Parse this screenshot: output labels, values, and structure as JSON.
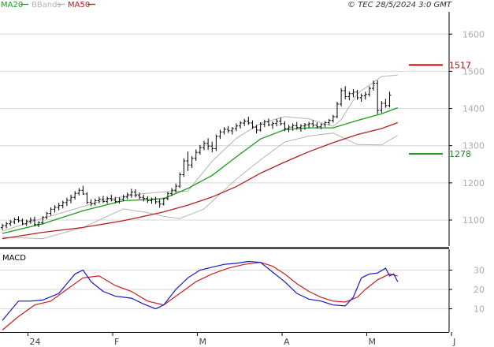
{
  "legend": [
    {
      "label": "MA20",
      "color": "#1a9c1a"
    },
    {
      "label": "BBands",
      "color": "#b4b4b4"
    },
    {
      "label": "MA50",
      "color": "#b41e1e"
    }
  ],
  "copyright": "© TEC 28/5/2024 3:0 GMT",
  "levels": [
    {
      "label": "1517",
      "value": 1517,
      "color": "#cc0000"
    },
    {
      "label": "1278",
      "value": 1278,
      "color": "#1a8c1a"
    }
  ],
  "chart_data": [
    {
      "type": "candlestick",
      "ylim": [
        1030,
        1660
      ],
      "yticks": [
        1100,
        1200,
        1300,
        1400,
        1500,
        1600
      ],
      "ytick_labels": [
        "1100",
        "1200",
        "1300",
        "1400",
        "1500",
        "1600"
      ],
      "x_labels": [
        "24",
        "F",
        "M",
        "A",
        "M",
        "J"
      ],
      "x_label_index": [
        4,
        25,
        46,
        67,
        88,
        109
      ],
      "grid": true,
      "bars": [
        [
          1080,
          1090,
          1073,
          1085
        ],
        [
          1085,
          1095,
          1078,
          1090
        ],
        [
          1090,
          1100,
          1084,
          1095
        ],
        [
          1095,
          1106,
          1089,
          1101
        ],
        [
          1101,
          1110,
          1093,
          1098
        ],
        [
          1098,
          1104,
          1086,
          1090
        ],
        [
          1090,
          1101,
          1084,
          1097
        ],
        [
          1097,
          1107,
          1090,
          1100
        ],
        [
          1100,
          1109,
          1083,
          1088
        ],
        [
          1088,
          1097,
          1081,
          1093
        ],
        [
          1093,
          1110,
          1088,
          1108
        ],
        [
          1108,
          1122,
          1102,
          1118
        ],
        [
          1118,
          1134,
          1112,
          1129
        ],
        [
          1129,
          1140,
          1120,
          1134
        ],
        [
          1134,
          1146,
          1126,
          1139
        ],
        [
          1139,
          1152,
          1131,
          1147
        ],
        [
          1147,
          1160,
          1138,
          1153
        ],
        [
          1153,
          1168,
          1145,
          1161
        ],
        [
          1161,
          1178,
          1155,
          1172
        ],
        [
          1172,
          1186,
          1166,
          1180
        ],
        [
          1180,
          1192,
          1168,
          1170
        ],
        [
          1170,
          1175,
          1143,
          1148
        ],
        [
          1148,
          1156,
          1137,
          1144
        ],
        [
          1144,
          1158,
          1139,
          1152
        ],
        [
          1152,
          1163,
          1145,
          1156
        ],
        [
          1156,
          1165,
          1146,
          1150
        ],
        [
          1150,
          1163,
          1144,
          1158
        ],
        [
          1158,
          1168,
          1150,
          1154
        ],
        [
          1154,
          1162,
          1145,
          1150
        ],
        [
          1150,
          1161,
          1144,
          1156
        ],
        [
          1156,
          1168,
          1150,
          1162
        ],
        [
          1162,
          1174,
          1156,
          1168
        ],
        [
          1168,
          1184,
          1160,
          1175
        ],
        [
          1175,
          1183,
          1161,
          1166
        ],
        [
          1166,
          1174,
          1156,
          1161
        ],
        [
          1161,
          1168,
          1150,
          1158
        ],
        [
          1158,
          1164,
          1146,
          1152
        ],
        [
          1152,
          1160,
          1144,
          1156
        ],
        [
          1156,
          1162,
          1143,
          1149
        ],
        [
          1149,
          1156,
          1133,
          1143
        ],
        [
          1143,
          1160,
          1139,
          1158
        ],
        [
          1158,
          1176,
          1153,
          1171
        ],
        [
          1171,
          1186,
          1165,
          1180
        ],
        [
          1180,
          1198,
          1174,
          1191
        ],
        [
          1191,
          1228,
          1186,
          1222
        ],
        [
          1222,
          1266,
          1216,
          1259
        ],
        [
          1259,
          1284,
          1232,
          1248
        ],
        [
          1248,
          1272,
          1240,
          1266
        ],
        [
          1266,
          1290,
          1259,
          1282
        ],
        [
          1282,
          1302,
          1276,
          1295
        ],
        [
          1295,
          1313,
          1288,
          1306
        ],
        [
          1306,
          1320,
          1289,
          1299
        ],
        [
          1299,
          1311,
          1282,
          1292
        ],
        [
          1292,
          1330,
          1286,
          1325
        ],
        [
          1325,
          1343,
          1318,
          1337
        ],
        [
          1337,
          1350,
          1330,
          1344
        ],
        [
          1344,
          1353,
          1334,
          1340
        ],
        [
          1340,
          1350,
          1330,
          1346
        ],
        [
          1346,
          1360,
          1339,
          1353
        ],
        [
          1353,
          1366,
          1346,
          1361
        ],
        [
          1361,
          1372,
          1353,
          1366
        ],
        [
          1366,
          1378,
          1356,
          1361
        ],
        [
          1361,
          1368,
          1345,
          1350
        ],
        [
          1350,
          1356,
          1333,
          1342
        ],
        [
          1342,
          1363,
          1338,
          1358
        ],
        [
          1358,
          1370,
          1350,
          1364
        ],
        [
          1364,
          1373,
          1352,
          1356
        ],
        [
          1356,
          1365,
          1345,
          1360
        ],
        [
          1360,
          1372,
          1352,
          1366
        ],
        [
          1366,
          1376,
          1354,
          1359
        ],
        [
          1359,
          1366,
          1339,
          1346
        ],
        [
          1346,
          1356,
          1336,
          1350
        ],
        [
          1350,
          1360,
          1340,
          1354
        ],
        [
          1354,
          1364,
          1343,
          1349
        ],
        [
          1349,
          1358,
          1338,
          1353
        ],
        [
          1353,
          1361,
          1343,
          1356
        ],
        [
          1356,
          1364,
          1347,
          1359
        ],
        [
          1359,
          1369,
          1350,
          1355
        ],
        [
          1355,
          1363,
          1346,
          1351
        ],
        [
          1351,
          1360,
          1344,
          1357
        ],
        [
          1357,
          1366,
          1350,
          1362
        ],
        [
          1362,
          1372,
          1355,
          1368
        ],
        [
          1368,
          1383,
          1362,
          1378
        ],
        [
          1378,
          1418,
          1374,
          1412
        ],
        [
          1412,
          1455,
          1406,
          1448
        ],
        [
          1448,
          1460,
          1425,
          1432
        ],
        [
          1432,
          1446,
          1422,
          1440
        ],
        [
          1440,
          1452,
          1430,
          1444
        ],
        [
          1444,
          1450,
          1423,
          1429
        ],
        [
          1429,
          1440,
          1418,
          1434
        ],
        [
          1434,
          1445,
          1424,
          1438
        ],
        [
          1438,
          1460,
          1432,
          1454
        ],
        [
          1454,
          1475,
          1448,
          1468
        ],
        [
          1468,
          1476,
          1385,
          1395
        ],
        [
          1395,
          1420,
          1388,
          1414
        ],
        [
          1414,
          1426,
          1402,
          1408
        ],
        [
          1408,
          1445,
          1403,
          1436
        ]
      ],
      "ma20": [
        [
          0,
          1064
        ],
        [
          10,
          1090
        ],
        [
          20,
          1125
        ],
        [
          30,
          1152
        ],
        [
          36,
          1155
        ],
        [
          40,
          1158
        ],
        [
          46,
          1185
        ],
        [
          52,
          1220
        ],
        [
          58,
          1270
        ],
        [
          64,
          1318
        ],
        [
          70,
          1343
        ],
        [
          76,
          1348
        ],
        [
          82,
          1348
        ],
        [
          88,
          1368
        ],
        [
          94,
          1386
        ],
        [
          98,
          1402
        ]
      ],
      "bb_upper": [
        [
          0,
          1070
        ],
        [
          8,
          1098
        ],
        [
          18,
          1130
        ],
        [
          26,
          1156
        ],
        [
          34,
          1170
        ],
        [
          40,
          1176
        ],
        [
          46,
          1178
        ],
        [
          52,
          1258
        ],
        [
          58,
          1320
        ],
        [
          64,
          1360
        ],
        [
          70,
          1378
        ],
        [
          76,
          1372
        ],
        [
          82,
          1352
        ],
        [
          84,
          1370
        ],
        [
          88,
          1440
        ],
        [
          94,
          1486
        ],
        [
          98,
          1490
        ]
      ],
      "bb_lower": [
        [
          0,
          1054
        ],
        [
          10,
          1050
        ],
        [
          20,
          1080
        ],
        [
          30,
          1130
        ],
        [
          36,
          1120
        ],
        [
          40,
          1110
        ],
        [
          44,
          1104
        ],
        [
          50,
          1130
        ],
        [
          58,
          1210
        ],
        [
          64,
          1262
        ],
        [
          70,
          1310
        ],
        [
          76,
          1326
        ],
        [
          82,
          1334
        ],
        [
          88,
          1303
        ],
        [
          94,
          1302
        ],
        [
          98,
          1328
        ]
      ],
      "ma50": [
        [
          0,
          1050
        ],
        [
          10,
          1067
        ],
        [
          20,
          1080
        ],
        [
          30,
          1098
        ],
        [
          36,
          1112
        ],
        [
          40,
          1122
        ],
        [
          46,
          1140
        ],
        [
          52,
          1162
        ],
        [
          58,
          1190
        ],
        [
          64,
          1226
        ],
        [
          70,
          1256
        ],
        [
          76,
          1284
        ],
        [
          82,
          1308
        ],
        [
          88,
          1330
        ],
        [
          94,
          1346
        ],
        [
          98,
          1362
        ]
      ]
    },
    {
      "type": "line",
      "title": "MACD",
      "ylim": [
        -2,
        40
      ],
      "yticks": [
        10,
        20,
        30
      ],
      "ytick_labels": [
        "10",
        "20",
        "30"
      ],
      "grid": true,
      "series": [
        {
          "color": "#1515c8",
          "points": [
            [
              0,
              4
            ],
            [
              4,
              14
            ],
            [
              7,
              14
            ],
            [
              10,
              14.5
            ],
            [
              14,
              18
            ],
            [
              18,
              28
            ],
            [
              20,
              30
            ],
            [
              22,
              24
            ],
            [
              25,
              19
            ],
            [
              28,
              16.5
            ],
            [
              32,
              15.5
            ],
            [
              35,
              12.5
            ],
            [
              38,
              10
            ],
            [
              40,
              12
            ],
            [
              43,
              20
            ],
            [
              46,
              26
            ],
            [
              49,
              30
            ],
            [
              52,
              31.5
            ],
            [
              55,
              33
            ],
            [
              58,
              33.5
            ],
            [
              61,
              34.5
            ],
            [
              64,
              34
            ],
            [
              67,
              29
            ],
            [
              70,
              24
            ],
            [
              73,
              18
            ],
            [
              76,
              15
            ],
            [
              79,
              14
            ],
            [
              82,
              12
            ],
            [
              85,
              11.5
            ],
            [
              87,
              16
            ],
            [
              89,
              26
            ],
            [
              91,
              28
            ],
            [
              93,
              28.5
            ],
            [
              95,
              31
            ],
            [
              96,
              27
            ],
            [
              97,
              28
            ],
            [
              98,
              24
            ]
          ]
        },
        {
          "color": "#c81e1e",
          "points": [
            [
              0,
              -1
            ],
            [
              4,
              6
            ],
            [
              8,
              12
            ],
            [
              12,
              14
            ],
            [
              16,
              20
            ],
            [
              20,
              26
            ],
            [
              24,
              27
            ],
            [
              28,
              22
            ],
            [
              32,
              19
            ],
            [
              36,
              14
            ],
            [
              40,
              12
            ],
            [
              44,
              18
            ],
            [
              48,
              24
            ],
            [
              52,
              28
            ],
            [
              56,
              31
            ],
            [
              60,
              33
            ],
            [
              64,
              34
            ],
            [
              67,
              32
            ],
            [
              70,
              28
            ],
            [
              73,
              23
            ],
            [
              76,
              19
            ],
            [
              79,
              16
            ],
            [
              82,
              14
            ],
            [
              85,
              13.5
            ],
            [
              88,
              16
            ],
            [
              90,
              20
            ],
            [
              93,
              25
            ],
            [
              96,
              28
            ],
            [
              98,
              27
            ]
          ]
        }
      ]
    }
  ]
}
